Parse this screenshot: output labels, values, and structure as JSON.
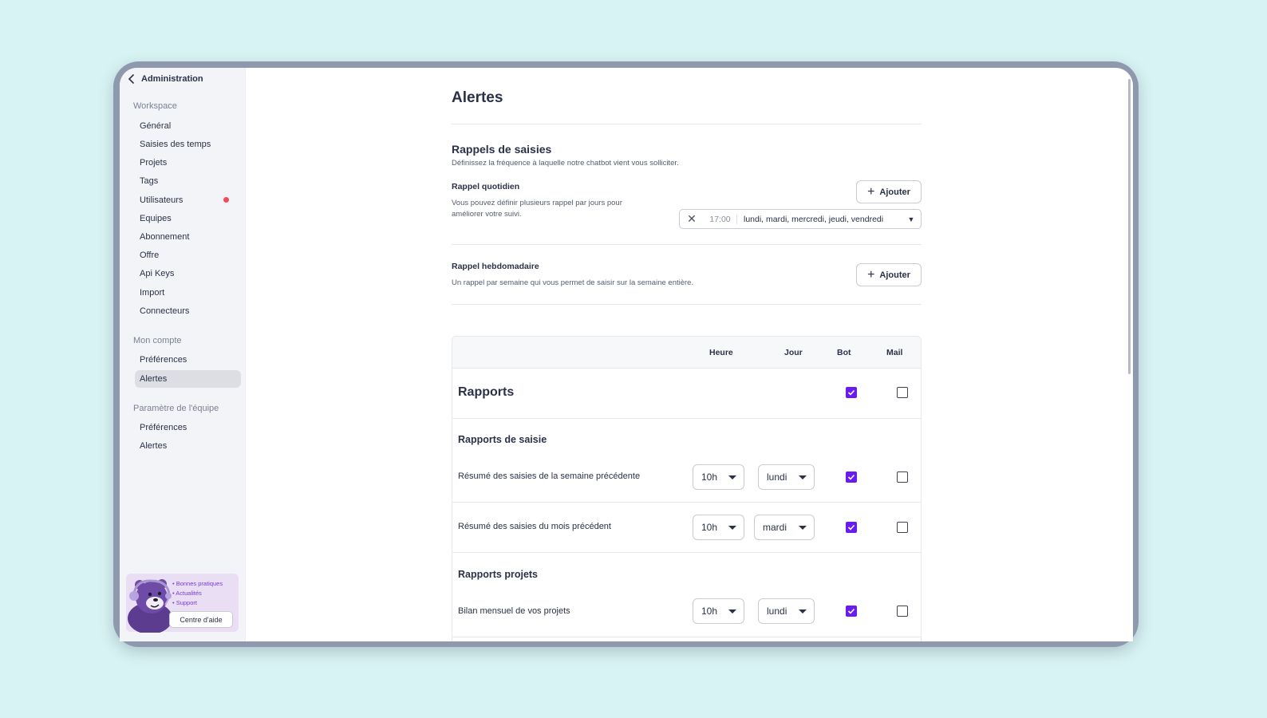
{
  "sidebar": {
    "back_label": "Administration",
    "workspace_label": "Workspace",
    "workspace_items": [
      "Général",
      "Saisies des temps",
      "Projets",
      "Tags",
      "Utilisateurs",
      "Equipes",
      "Abonnement",
      "Offre",
      "Api Keys",
      "Import",
      "Connecteurs"
    ],
    "account_label": "Mon compte",
    "account_items": [
      "Préférences",
      "Alertes"
    ],
    "team_label": "Paramètre de l'équipe",
    "team_items": [
      "Préférences",
      "Alertes"
    ],
    "active_item": "Alertes",
    "help": {
      "items": [
        "• Bonnes pratiques",
        "• Actualités",
        "• Support"
      ],
      "button": "Centre d'aide"
    }
  },
  "page": {
    "title": "Alertes",
    "reminders": {
      "title": "Rappels de saisies",
      "subtitle": "Définissez la fréquence à laquelle notre chatbot vient vous solliciter.",
      "daily": {
        "label": "Rappel quotidien",
        "description_line1": "Vous pouvez définir plusieurs rappel par jours pour",
        "description_line2": "améliorer votre suivi.",
        "add_label": "Ajouter",
        "entry": {
          "time": "17:00",
          "days": "lundi, mardi, mercredi, jeudi, vendredi"
        }
      },
      "weekly": {
        "label": "Rappel hebdomadaire",
        "description": "Un rappel par semaine qui vous permet de saisir sur la semaine entière.",
        "add_label": "Ajouter"
      }
    },
    "table": {
      "headers": {
        "hour": "Heure",
        "day": "Jour",
        "bot": "Bot",
        "mail": "Mail"
      },
      "section_title": "Rapports",
      "section_bot": true,
      "section_mail": false,
      "groups": [
        {
          "title": "Rapports de saisie",
          "rows": [
            {
              "label": "Résumé des saisies de la semaine précédente",
              "hour": "10h",
              "day": "lundi",
              "bot": true,
              "mail": false
            },
            {
              "label": "Résumé des saisies du mois précédent",
              "hour": "10h",
              "day": "mardi",
              "bot": true,
              "mail": false
            }
          ]
        },
        {
          "title": "Rapports projets",
          "rows": [
            {
              "label": "Bilan mensuel de vos projets",
              "hour": "10h",
              "day": "lundi",
              "bot": true,
              "mail": false
            }
          ]
        }
      ]
    }
  },
  "colors": {
    "accent": "#6a1cf0",
    "notification": "#ef4b5a",
    "background": "#d8f3f3"
  }
}
